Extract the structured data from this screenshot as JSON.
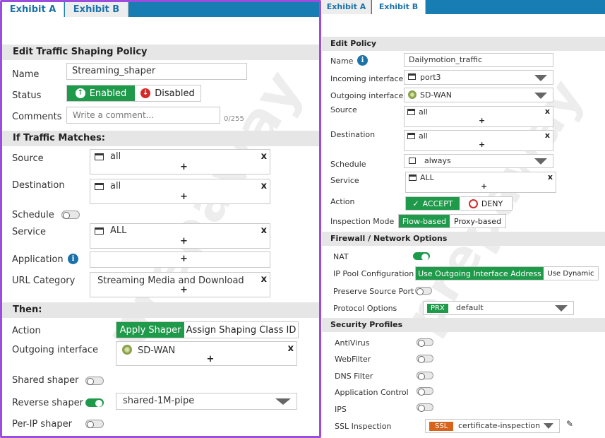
{
  "tabs": {
    "exhibit_a": "Exhibit A",
    "exhibit_b": "Exhibit B"
  },
  "watermark": "prepaway",
  "exhibit_a": {
    "section_title": "Edit Traffic Shaping Policy",
    "name_label": "Name",
    "name_value": "Streaming_shaper",
    "status_label": "Status",
    "status_enabled": "Enabled",
    "status_disabled": "Disabled",
    "comments_label": "Comments",
    "comments_placeholder": "Write a comment...",
    "comments_counter": "0/255",
    "match_title": "If Traffic Matches:",
    "source_label": "Source",
    "source_value": "all",
    "destination_label": "Destination",
    "destination_value": "all",
    "schedule_label": "Schedule",
    "service_label": "Service",
    "service_value": "ALL",
    "application_label": "Application",
    "url_category_label": "URL Category",
    "url_category_value": "Streaming Media and Download",
    "then_title": "Then:",
    "action_label": "Action",
    "action_apply": "Apply Shaper",
    "action_assign": "Assign Shaping Class ID",
    "outgoing_label": "Outgoing interface",
    "outgoing_value": "SD-WAN",
    "shared_shaper_label": "Shared shaper",
    "reverse_shaper_label": "Reverse shaper",
    "reverse_shaper_value": "shared-1M-pipe",
    "per_ip_label": "Per-IP shaper",
    "plus": "+",
    "remove": "x"
  },
  "exhibit_b": {
    "section_title": "Edit Policy",
    "name_label": "Name",
    "name_value": "Dailymotion_traffic",
    "incoming_label": "Incoming interface",
    "incoming_value": "port3",
    "outgoing_label": "Outgoing interface",
    "outgoing_value": "SD-WAN",
    "source_label": "Source",
    "source_value": "all",
    "destination_label": "Destination",
    "destination_value": "all",
    "schedule_label": "Schedule",
    "schedule_value": "always",
    "service_label": "Service",
    "service_value": "ALL",
    "action_label": "Action",
    "action_accept": "ACCEPT",
    "action_deny": "DENY",
    "inspection_label": "Inspection Mode",
    "inspection_flow": "Flow-based",
    "inspection_proxy": "Proxy-based",
    "fw_title": "Firewall / Network Options",
    "nat_label": "NAT",
    "ippool_label": "IP Pool Configuration",
    "ippool_outgoing": "Use Outgoing Interface Address",
    "ippool_dynamic": "Use Dynamic",
    "preserve_label": "Preserve Source Port",
    "protocol_label": "Protocol Options",
    "protocol_badge": "PRX",
    "protocol_value": "default",
    "security_title": "Security Profiles",
    "antivirus_label": "AntiVirus",
    "webfilter_label": "WebFilter",
    "dns_label": "DNS Filter",
    "appcontrol_label": "Application Control",
    "ips_label": "IPS",
    "ssl_label": "SSL Inspection",
    "ssl_badge": "SSL",
    "ssl_value": "certificate-inspection",
    "plus": "+",
    "remove": "x"
  },
  "colors": {
    "accent_green": "#1f9a4a",
    "tab_blue": "#177db3",
    "danger_red": "#d42a2a",
    "panel_border": "#9b4dde",
    "ssl_orange": "#d8641b"
  }
}
